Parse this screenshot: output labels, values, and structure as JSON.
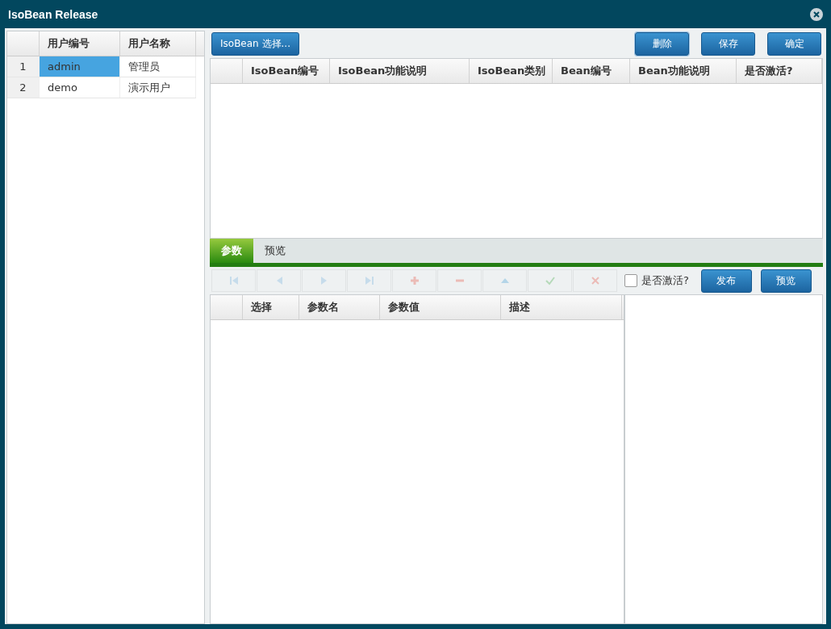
{
  "window": {
    "title": "IsoBean Release"
  },
  "users": {
    "columns": [
      "用户编号",
      "用户名称"
    ],
    "rows": [
      {
        "index": "1",
        "id": "admin",
        "name": "管理员",
        "selected": true
      },
      {
        "index": "2",
        "id": "demo",
        "name": "演示用户",
        "selected": false
      }
    ]
  },
  "top_toolbar": {
    "select_button": "IsoBean 选择...",
    "buttons": [
      "删除",
      "保存",
      "确定"
    ]
  },
  "bean_table": {
    "columns": [
      "IsoBean编号",
      "IsoBean功能说明",
      "IsoBean类别",
      "Bean编号",
      "Bean功能说明",
      "是否激活?"
    ]
  },
  "tabs": [
    {
      "label": "参数",
      "selected": true
    },
    {
      "label": "预览",
      "selected": false
    }
  ],
  "param_toolbar": {
    "tools": [
      {
        "kind": "first",
        "disabled": true
      },
      {
        "kind": "prev",
        "disabled": true
      },
      {
        "kind": "next",
        "disabled": true
      },
      {
        "kind": "last",
        "disabled": true
      },
      {
        "kind": "add",
        "disabled": true
      },
      {
        "kind": "remove",
        "disabled": true
      },
      {
        "kind": "up",
        "disabled": true
      },
      {
        "kind": "confirm",
        "disabled": true
      },
      {
        "kind": "cancel",
        "disabled": true
      }
    ],
    "active_checkbox": {
      "label": "是否激活?",
      "checked": false
    },
    "buttons": [
      "发布",
      "预览"
    ]
  },
  "param_table": {
    "columns": [
      "选择",
      "参数名",
      "参数值",
      "描述"
    ]
  }
}
